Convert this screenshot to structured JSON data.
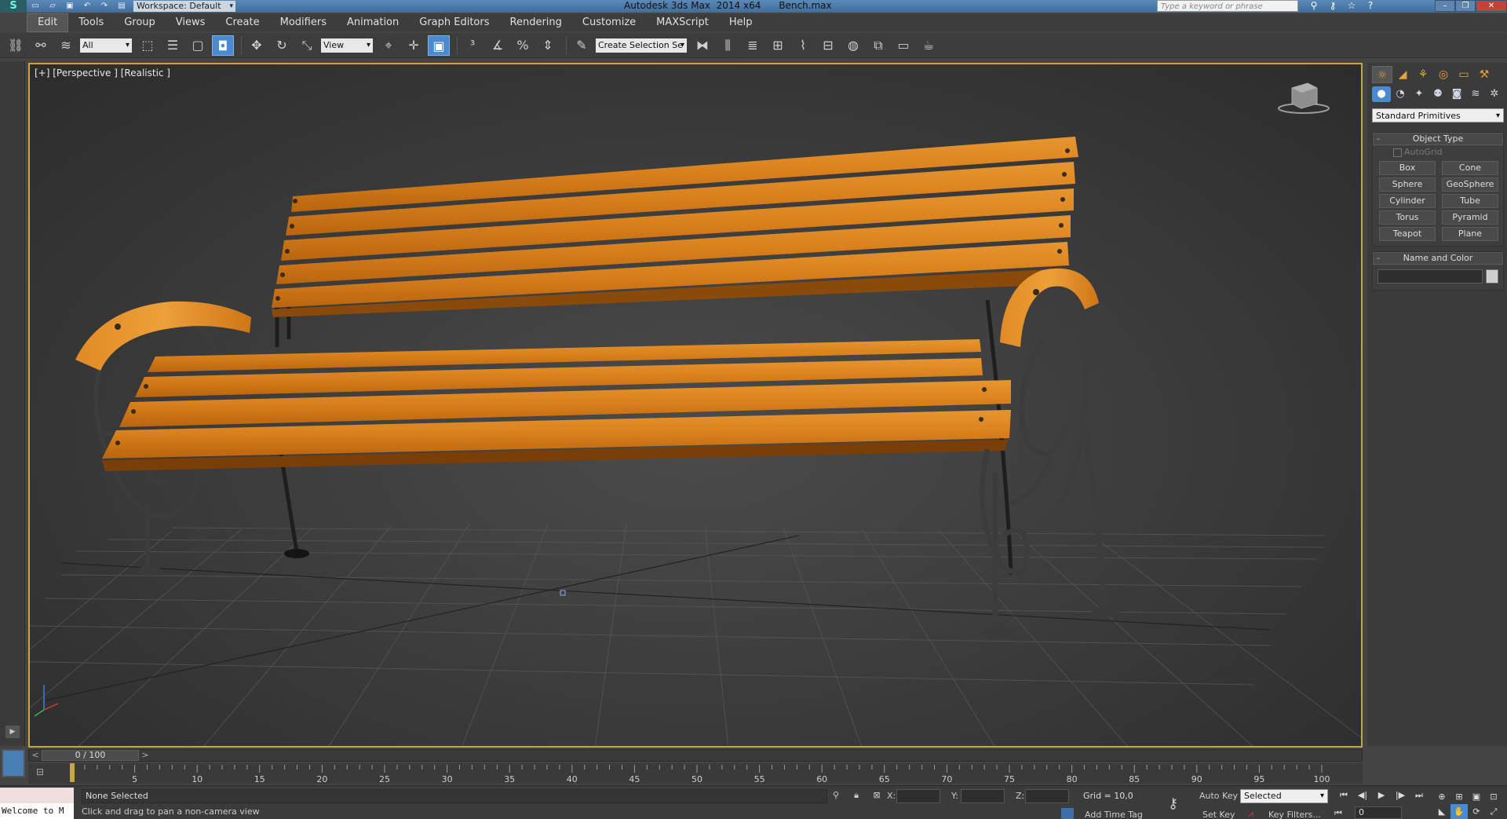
{
  "titlebar": {
    "logo": "S",
    "quick_access": [
      "new-file",
      "open",
      "save",
      "undo",
      "redo",
      "project"
    ],
    "workspace": "Workspace: Default",
    "title": "Autodesk 3ds Max  2014 x64",
    "file": "Bench.max",
    "search_placeholder": "Type a keyword or phrase",
    "icons": [
      "binoculars",
      "key",
      "star",
      "help"
    ],
    "window_controls": [
      "minimize",
      "restore",
      "close"
    ]
  },
  "menu": [
    "Edit",
    "Tools",
    "Group",
    "Views",
    "Create",
    "Modifiers",
    "Animation",
    "Graph Editors",
    "Rendering",
    "Customize",
    "MAXScript",
    "Help"
  ],
  "toolbar": {
    "filter": "All",
    "ref_coord": "View",
    "selection_set": "Create Selection Se"
  },
  "viewport": {
    "label": "[+] [Perspective ] [Realistic ]"
  },
  "command_panel": {
    "category": "Standard Primitives",
    "object_type_title": "Object Type",
    "autogrid": "AutoGrid",
    "buttons": [
      "Box",
      "Cone",
      "Sphere",
      "GeoSphere",
      "Cylinder",
      "Tube",
      "Torus",
      "Pyramid",
      "Teapot",
      "Plane"
    ],
    "name_color_title": "Name and Color"
  },
  "timeline": {
    "frame_display": "0 / 100",
    "ticks": [
      "5",
      "10",
      "15",
      "20",
      "25",
      "30",
      "35",
      "40",
      "45",
      "50",
      "55",
      "60",
      "65",
      "70",
      "75",
      "80",
      "85",
      "90",
      "95",
      "100"
    ]
  },
  "status": {
    "maxscript_line1": "",
    "maxscript_line2": "Welcome to M",
    "selection": "None Selected",
    "prompt": "Click and drag to pan a non-camera view",
    "x_label": "X:",
    "y_label": "Y:",
    "z_label": "Z:",
    "grid": "Grid = 10,0",
    "add_time_tag": "Add Time Tag",
    "auto_key": "Auto Key",
    "set_key": "Set Key",
    "key_mode": "Selected",
    "key_filters": "Key Filters...",
    "current_frame": "0"
  }
}
